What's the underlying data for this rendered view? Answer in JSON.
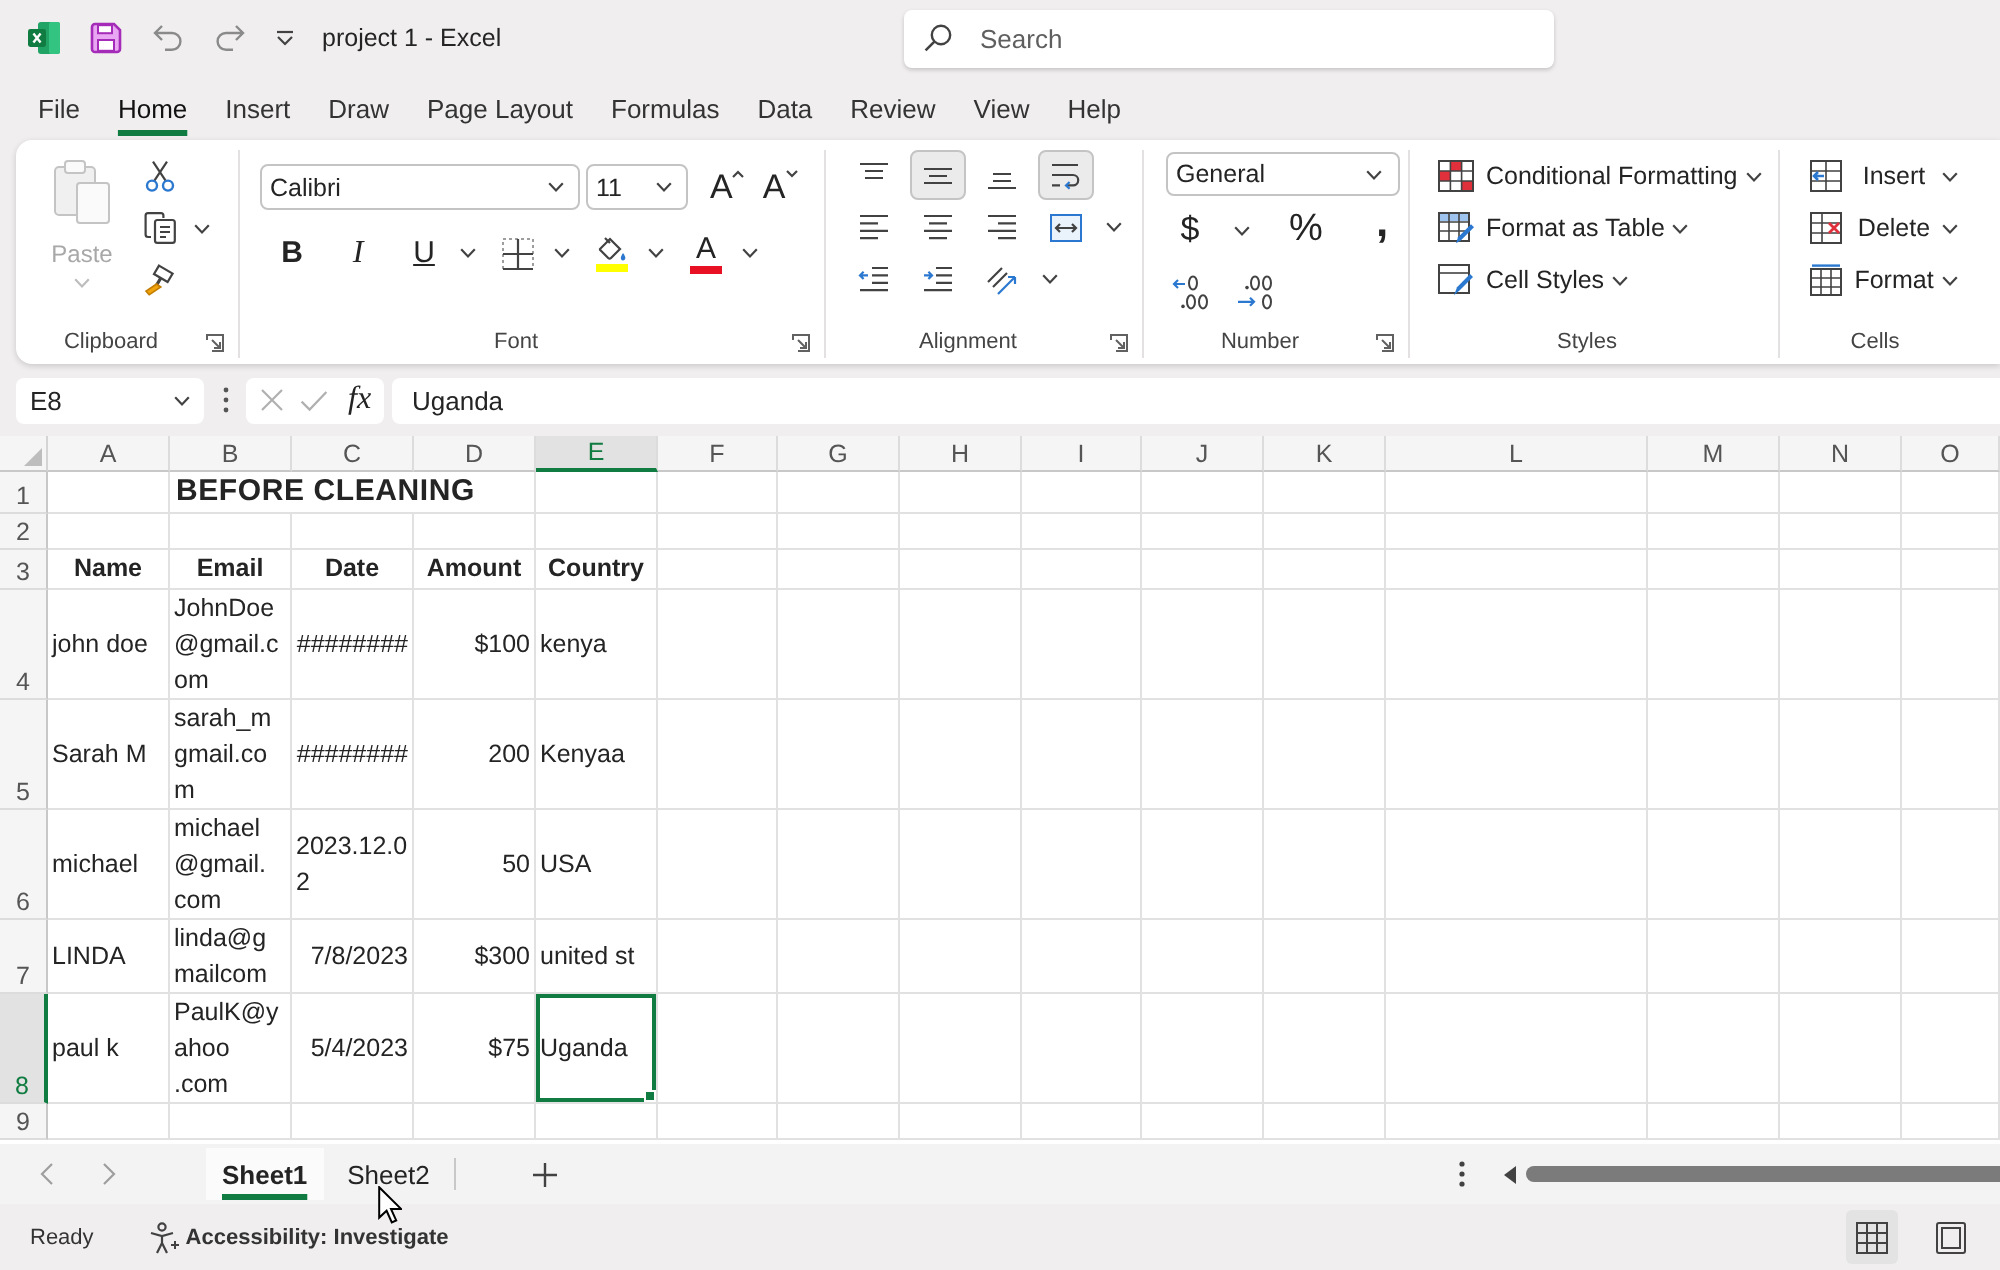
{
  "window": {
    "title": "project 1 - Excel"
  },
  "search": {
    "placeholder": "Search"
  },
  "menu_tabs": [
    {
      "label": "File",
      "selected": false
    },
    {
      "label": "Home",
      "selected": true
    },
    {
      "label": "Insert",
      "selected": false
    },
    {
      "label": "Draw",
      "selected": false
    },
    {
      "label": "Page Layout",
      "selected": false
    },
    {
      "label": "Formulas",
      "selected": false
    },
    {
      "label": "Data",
      "selected": false
    },
    {
      "label": "Review",
      "selected": false
    },
    {
      "label": "View",
      "selected": false
    },
    {
      "label": "Help",
      "selected": false
    }
  ],
  "ribbon": {
    "groups": [
      {
        "kind": "clipboard",
        "label": "Clipboard",
        "launcher": true,
        "paste": {
          "label": "Paste",
          "disabled": true
        },
        "tools": [
          {
            "kind": "cut",
            "dropdown": false
          },
          {
            "kind": "copy",
            "dropdown": true
          },
          {
            "kind": "format_painter",
            "dropdown": false
          }
        ]
      },
      {
        "kind": "font",
        "label": "Font",
        "launcher": true,
        "font_name": "Calibri",
        "font_size": "11",
        "size_buttons": [
          {
            "kind": "grow",
            "label": "A"
          },
          {
            "kind": "shrink",
            "label": "A"
          }
        ],
        "format_buttons": [
          {
            "kind": "bold",
            "label": "B",
            "dropdown": false
          },
          {
            "kind": "italic",
            "label": "I",
            "dropdown": false
          },
          {
            "kind": "underline",
            "label": "U",
            "dropdown": true
          },
          {
            "kind": "borders",
            "dropdown": true
          },
          {
            "kind": "fill_color",
            "dropdown": true,
            "color": "#ffff00"
          },
          {
            "kind": "font_color",
            "label": "A",
            "dropdown": true,
            "color": "#e81123"
          }
        ]
      },
      {
        "kind": "alignment",
        "label": "Alignment",
        "launcher": true,
        "rows": [
          {
            "buttons": [
              {
                "kind": "align_top",
                "selected": false,
                "dropdown": false
              },
              {
                "kind": "align_middle",
                "selected": true,
                "dropdown": false
              },
              {
                "kind": "align_bottom",
                "selected": false,
                "dropdown": false
              },
              {
                "kind": "wrap_text",
                "selected": true,
                "dropdown": false
              }
            ]
          },
          {
            "buttons": [
              {
                "kind": "align_left",
                "selected": false,
                "dropdown": false
              },
              {
                "kind": "align_center",
                "selected": false,
                "dropdown": false
              },
              {
                "kind": "align_right",
                "selected": false,
                "dropdown": false
              },
              {
                "kind": "merge",
                "selected": false,
                "dropdown": true
              }
            ]
          },
          {
            "buttons": [
              {
                "kind": "indent_decrease",
                "selected": false,
                "dropdown": false
              },
              {
                "kind": "indent_increase",
                "selected": false,
                "dropdown": false
              },
              {
                "kind": "orientation",
                "selected": false,
                "dropdown": true
              }
            ]
          }
        ]
      },
      {
        "kind": "number",
        "label": "Number",
        "launcher": true,
        "format": "General",
        "buttons": [
          {
            "kind": "currency",
            "label": "$",
            "dropdown": true
          },
          {
            "kind": "percent",
            "label": "%",
            "dropdown": false
          },
          {
            "kind": "comma",
            "label": ",",
            "dropdown": false
          }
        ],
        "decimal_buttons": [
          {
            "kind": "increase"
          },
          {
            "kind": "decrease"
          }
        ]
      },
      {
        "kind": "styles",
        "label": "Styles",
        "launcher": false,
        "buttons": [
          {
            "kind": "conditional_formatting",
            "label": "Conditional Formatting",
            "dropdown": true
          },
          {
            "kind": "format_as_table",
            "label": "Format as Table",
            "dropdown": true
          },
          {
            "kind": "cell_styles",
            "label": "Cell Styles",
            "dropdown": true
          }
        ]
      },
      {
        "kind": "cells",
        "label": "Cells",
        "launcher": false,
        "buttons": [
          {
            "kind": "insert",
            "label": "Insert",
            "dropdown": true
          },
          {
            "kind": "delete",
            "label": "Delete",
            "dropdown": true
          },
          {
            "kind": "format",
            "label": "Format",
            "dropdown": true
          }
        ]
      }
    ]
  },
  "formula_bar": {
    "name_box": "E8",
    "function_label": "fx",
    "formula": "Uganda"
  },
  "sheet": {
    "columns": [
      {
        "label": "A",
        "selected": false
      },
      {
        "label": "B",
        "selected": false
      },
      {
        "label": "C",
        "selected": false
      },
      {
        "label": "D",
        "selected": false
      },
      {
        "label": "E",
        "selected": true
      },
      {
        "label": "F",
        "selected": false
      },
      {
        "label": "G",
        "selected": false
      },
      {
        "label": "H",
        "selected": false
      },
      {
        "label": "I",
        "selected": false
      },
      {
        "label": "J",
        "selected": false
      },
      {
        "label": "K",
        "selected": false
      },
      {
        "label": "L",
        "selected": false
      },
      {
        "label": "M",
        "selected": false
      },
      {
        "label": "N",
        "selected": false
      },
      {
        "label": "O",
        "selected": false
      }
    ],
    "rows": [
      {
        "number": "1",
        "selected": false,
        "cells": [
          null,
          {
            "kind": "title",
            "text": "BEFORE CLEANING",
            "selected": false
          }
        ]
      },
      {
        "number": "2",
        "selected": false
      },
      {
        "number": "3",
        "selected": false,
        "cells": [
          {
            "kind": "header",
            "text": "Name",
            "selected": false
          },
          {
            "kind": "header",
            "text": "Email",
            "selected": false
          },
          {
            "kind": "header",
            "text": "Date",
            "selected": false
          },
          {
            "kind": "header",
            "text": "Amount",
            "selected": false
          },
          {
            "kind": "header",
            "text": "Country",
            "selected": false
          }
        ]
      },
      {
        "number": "4",
        "selected": false,
        "cells": [
          {
            "kind": "text",
            "text": "john doe",
            "selected": false
          },
          {
            "kind": "text",
            "text": "JohnDoe\n@gmail.c\nom",
            "selected": false
          },
          {
            "kind": "number",
            "text": "########",
            "selected": false
          },
          {
            "kind": "number",
            "text": "$100",
            "selected": false
          },
          {
            "kind": "text",
            "text": "kenya",
            "selected": false
          }
        ]
      },
      {
        "number": "5",
        "selected": false,
        "cells": [
          {
            "kind": "text",
            "text": "Sarah M",
            "selected": false
          },
          {
            "kind": "text",
            "text": "sarah_m\ngmail.co\nm",
            "selected": false
          },
          {
            "kind": "number",
            "text": "########",
            "selected": false
          },
          {
            "kind": "number",
            "text": "200",
            "selected": false
          },
          {
            "kind": "text",
            "text": "Kenyaa",
            "selected": false
          }
        ]
      },
      {
        "number": "6",
        "selected": false,
        "cells": [
          {
            "kind": "text",
            "text": "michael",
            "selected": false
          },
          {
            "kind": "text",
            "text": "michael\n@gmail.\ncom",
            "selected": false
          },
          {
            "kind": "text",
            "text": "2023.12.0\n2",
            "selected": false
          },
          {
            "kind": "number",
            "text": "50",
            "selected": false
          },
          {
            "kind": "text",
            "text": "USA",
            "selected": false
          }
        ]
      },
      {
        "number": "7",
        "selected": false,
        "cells": [
          {
            "kind": "text",
            "text": "LINDA",
            "selected": false
          },
          {
            "kind": "text",
            "text": "linda@g\nmailcom",
            "selected": false
          },
          {
            "kind": "number",
            "text": "7/8/2023",
            "selected": false
          },
          {
            "kind": "number",
            "text": "$300",
            "selected": false
          },
          {
            "kind": "text",
            "text": "united st",
            "selected": false
          }
        ]
      },
      {
        "number": "8",
        "selected": true,
        "cells": [
          {
            "kind": "text",
            "text": "paul k",
            "selected": false
          },
          {
            "kind": "text",
            "text": "PaulK@y\nahoo\n.com",
            "selected": false
          },
          {
            "kind": "number",
            "text": "5/4/2023",
            "selected": false
          },
          {
            "kind": "number",
            "text": "$75",
            "selected": false
          },
          {
            "kind": "text",
            "text": "Uganda",
            "selected": true
          }
        ]
      },
      {
        "number": "9",
        "selected": false
      }
    ]
  },
  "sheet_tabs": [
    {
      "label": "Sheet1",
      "selected": true
    },
    {
      "label": "Sheet2",
      "selected": false
    }
  ],
  "status_bar": {
    "status": "Ready",
    "accessibility": "Accessibility: Investigate",
    "view_buttons": [
      {
        "kind": "normal",
        "selected": true
      },
      {
        "kind": "page_layout",
        "selected": false
      }
    ]
  }
}
